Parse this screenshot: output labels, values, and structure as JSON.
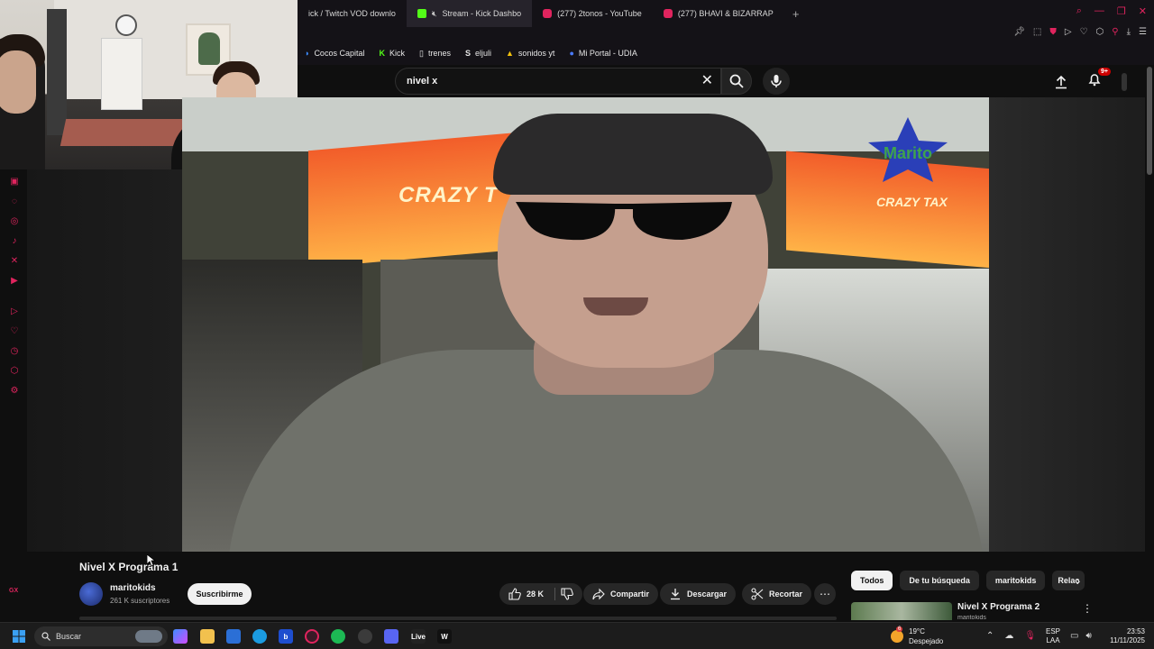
{
  "browser": {
    "tabs": [
      {
        "label": "ick / Twitch VOD downlo",
        "icon": "download-icon",
        "active": false
      },
      {
        "label": "Stream - Kick Dashbo",
        "icon": "kick-icon",
        "active": true
      },
      {
        "label": "(277) 2tonos - YouTube",
        "icon": "youtube-icon",
        "active": false
      },
      {
        "label": "(277) BHAVI & BIZARRAP",
        "icon": "youtube-icon",
        "active": false
      }
    ],
    "new_tab": "+",
    "bookmarks": [
      {
        "label": "Cocos Capital",
        "icon": "cocos-icon"
      },
      {
        "label": "Kick",
        "icon": "kick-icon"
      },
      {
        "label": "trenes",
        "icon": "page-icon"
      },
      {
        "label": "eljuli",
        "icon": "s-icon"
      },
      {
        "label": "sonidos yt",
        "icon": "drive-icon"
      },
      {
        "label": "Mi Portal - UDIA",
        "icon": "udia-icon"
      }
    ],
    "accent_color": "#e0245e"
  },
  "youtube": {
    "search_value": "nivel x",
    "notification_badge": "9+",
    "video": {
      "overlay_text_left": "CRAZY T",
      "overlay_text_right": "CRAZY TAX",
      "logo_text": "Marito"
    },
    "title": "Nivel X Programa 1",
    "channel": {
      "name": "maritokids",
      "subscribers": "261 K suscriptores"
    },
    "subscribe_label": "Suscribirme",
    "actions": {
      "likes": "28 K",
      "share": "Compartir",
      "download": "Descargar",
      "clip": "Recortar",
      "more": "⋯"
    },
    "chips": [
      "Todos",
      "De tu búsqueda",
      "maritokids",
      "Relac"
    ],
    "recommendation": {
      "title": "Nivel X Programa 2",
      "channel": "maritokids"
    }
  },
  "taskbar": {
    "search_label": "Buscar",
    "weather": {
      "temp": "19°C",
      "condition": "Despejado",
      "badge": "6"
    },
    "language": {
      "line1": "ESP",
      "line2": "LAA"
    },
    "clock": {
      "time": "23:53",
      "date": "11/11/2025"
    }
  },
  "sidebar_corner": "GX"
}
